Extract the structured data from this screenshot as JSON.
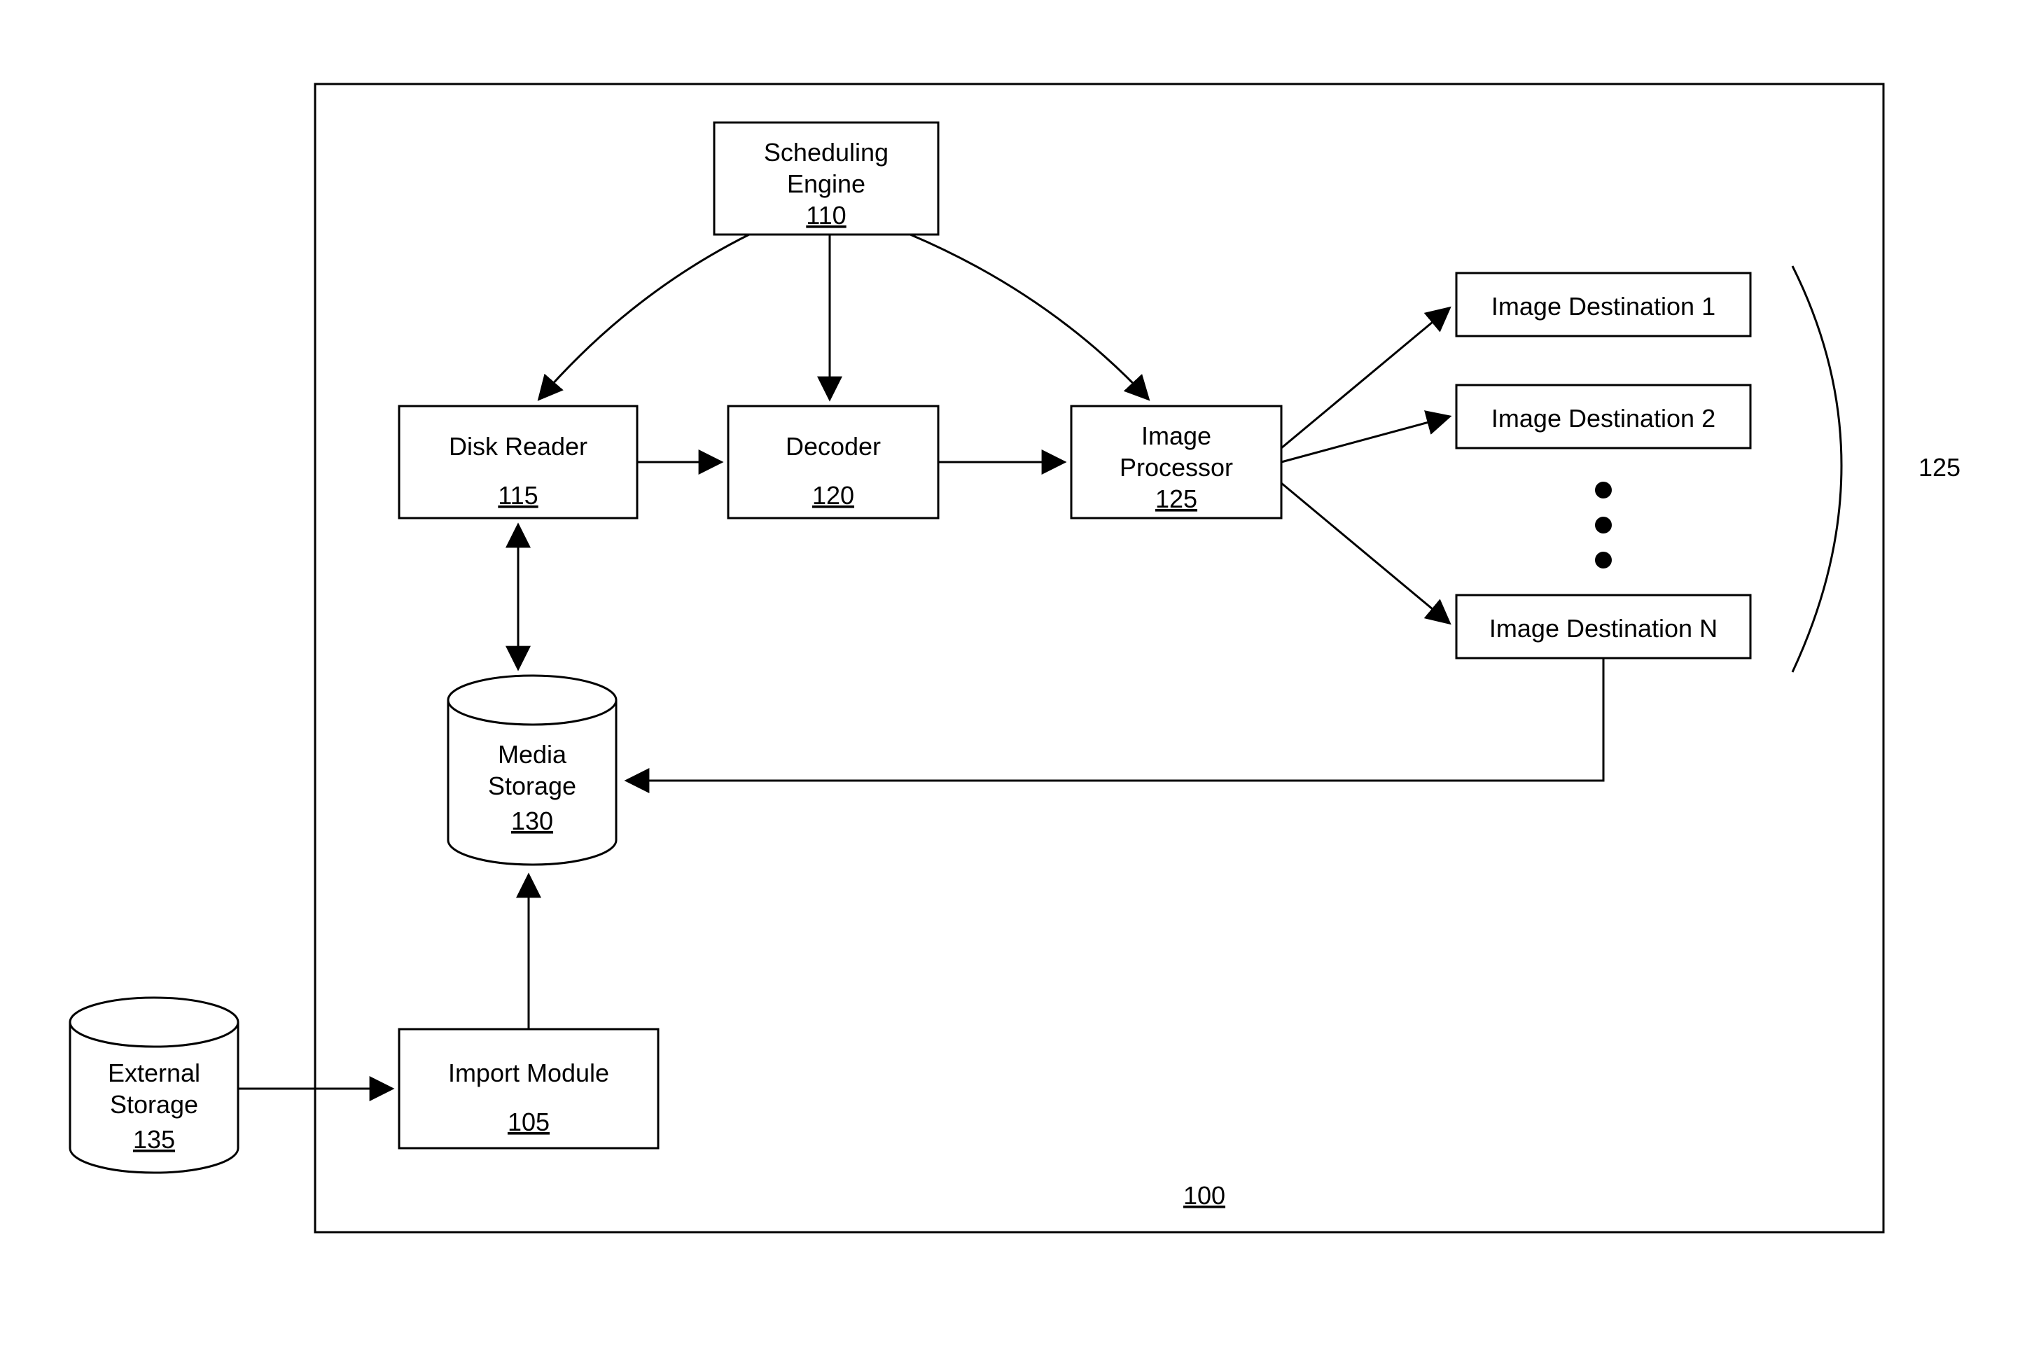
{
  "system": {
    "ref": "100"
  },
  "scheduler": {
    "label": "Scheduling",
    "label2": "Engine",
    "ref": "110"
  },
  "diskReader": {
    "label": "Disk Reader",
    "ref": "115"
  },
  "decoder": {
    "label": "Decoder",
    "ref": "120"
  },
  "imageProcessor": {
    "label": "Image",
    "label2": "Processor",
    "ref": "125"
  },
  "mediaStorage": {
    "label": "Media",
    "label2": "Storage",
    "ref": "130"
  },
  "importModule": {
    "label": "Import Module",
    "ref": "105"
  },
  "externalStorage": {
    "label": "External",
    "label2": "Storage",
    "ref": "135"
  },
  "dest1": {
    "label": "Image Destination 1"
  },
  "dest2": {
    "label": "Image Destination 2"
  },
  "destN": {
    "label": "Image Destination N"
  },
  "destGroupRef": "125"
}
